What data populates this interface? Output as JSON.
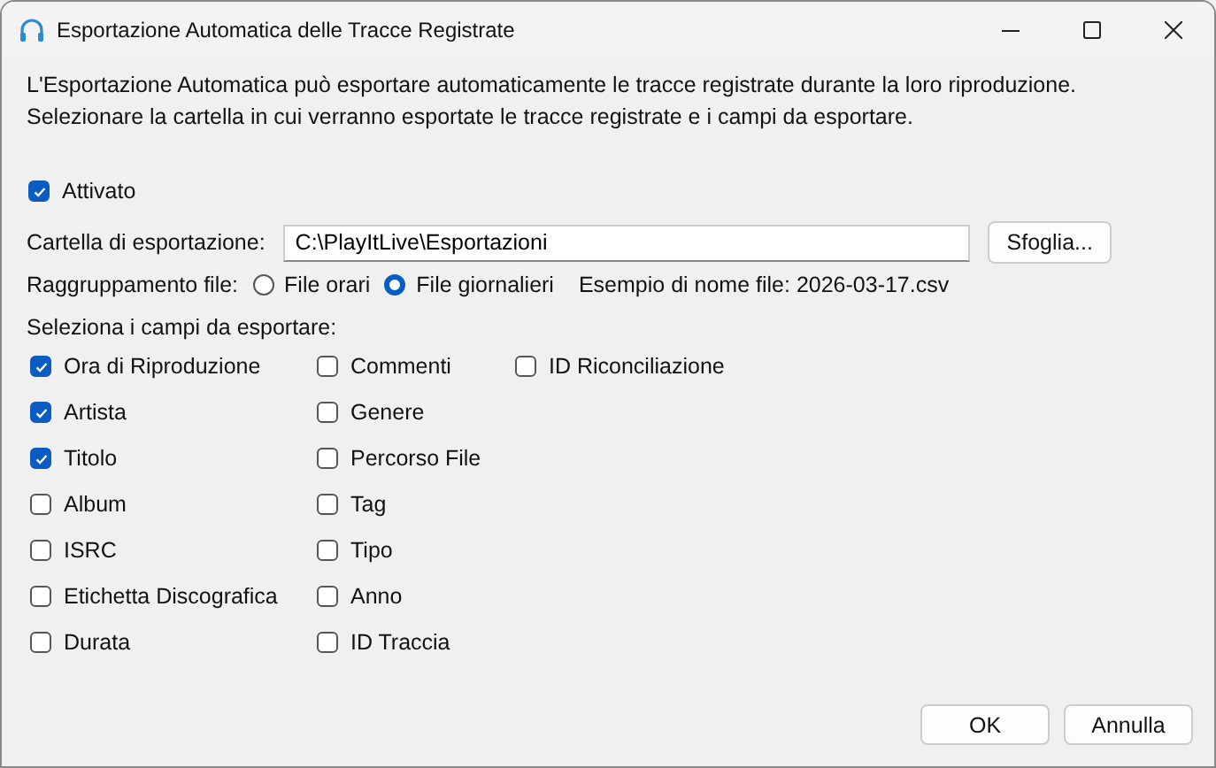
{
  "window": {
    "title": "Esportazione Automatica delle Tracce Registrate"
  },
  "description": [
    "L'Esportazione Automatica può esportare automaticamente le tracce registrate durante la loro riproduzione.",
    "Selezionare la cartella in cui verranno esportate le tracce registrate e i campi da esportare."
  ],
  "enabled": {
    "label": "Attivato",
    "checked": true
  },
  "folder": {
    "label": "Cartella di esportazione:",
    "value": "C:\\PlayItLive\\Esportazioni",
    "button": "Sfoglia..."
  },
  "grouping": {
    "label": "Raggruppamento file:",
    "options": [
      {
        "label": "File orari",
        "selected": false
      },
      {
        "label": "File giornalieri",
        "selected": true
      }
    ],
    "example": "Esempio di nome file: 2026-03-17.csv"
  },
  "fields_label": "Seleziona i campi da esportare:",
  "field_columns": [
    [
      {
        "label": "Ora di Riproduzione",
        "checked": true
      },
      {
        "label": "Artista",
        "checked": true
      },
      {
        "label": "Titolo",
        "checked": true
      },
      {
        "label": "Album",
        "checked": false
      },
      {
        "label": "ISRC",
        "checked": false
      },
      {
        "label": "Etichetta Discografica",
        "checked": false
      },
      {
        "label": "Durata",
        "checked": false
      }
    ],
    [
      {
        "label": "Commenti",
        "checked": false
      },
      {
        "label": "Genere",
        "checked": false
      },
      {
        "label": "Percorso File",
        "checked": false
      },
      {
        "label": "Tag",
        "checked": false
      },
      {
        "label": "Tipo",
        "checked": false
      },
      {
        "label": "Anno",
        "checked": false
      },
      {
        "label": "ID Traccia",
        "checked": false
      }
    ],
    [
      {
        "label": "ID Riconciliazione",
        "checked": false
      }
    ]
  ],
  "buttons": [
    "OK",
    "Annulla"
  ]
}
